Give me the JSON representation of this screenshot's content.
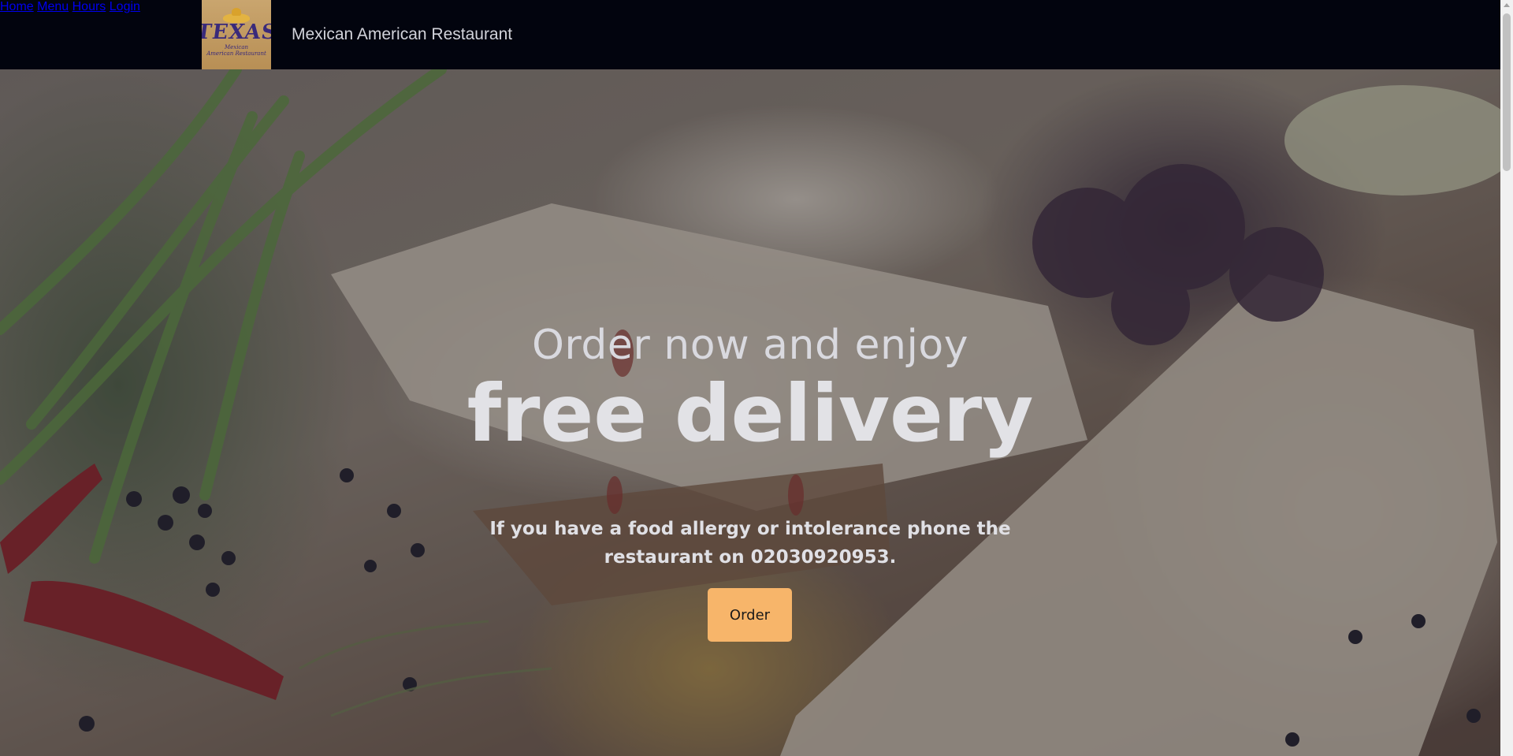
{
  "header": {
    "logo": {
      "brand": "TEXAS",
      "sub_line1": "Mexican",
      "sub_line2": "American Restaurant"
    },
    "site_title": "Mexican American Restaurant",
    "nav": [
      {
        "label": "Home",
        "active": true
      },
      {
        "label": "Menu",
        "active": false
      },
      {
        "label": "Hours",
        "active": false
      },
      {
        "label": "Login",
        "active": false
      }
    ]
  },
  "hero": {
    "line1": "Order now and enjoy",
    "line2": "free delivery",
    "note": "If you have a food allergy or intolerance phone the restaurant on 02030920953.",
    "order_button": "Order"
  },
  "colors": {
    "header_bg": "#02040e",
    "nav_active": "#f4a547",
    "button_bg": "#f7b56a"
  }
}
